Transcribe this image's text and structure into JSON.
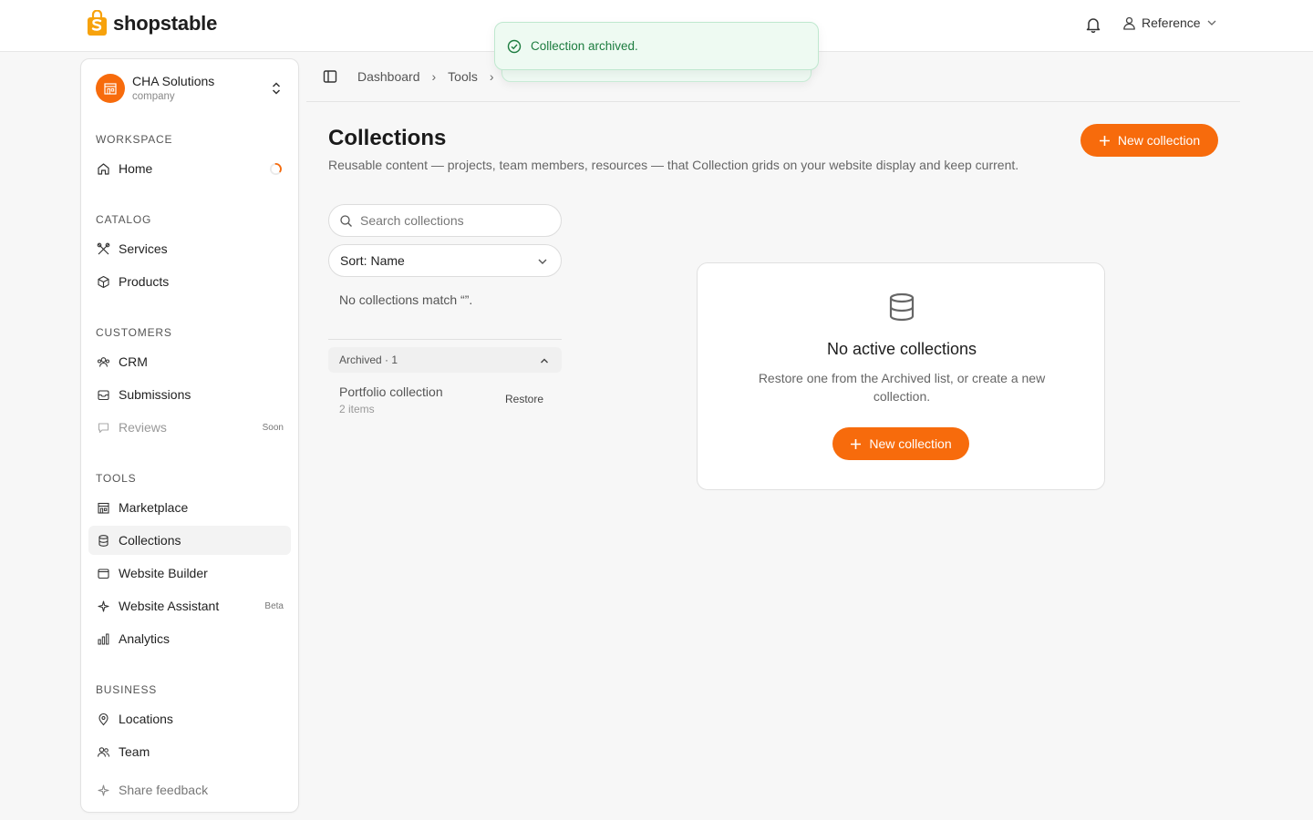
{
  "brand": {
    "name": "shopstable",
    "accent": "#f76b0c"
  },
  "header": {
    "user_label": "Reference"
  },
  "toast": {
    "message": "Collection archived.",
    "color": "#1c7c3f"
  },
  "org": {
    "name": "CHA Solutions",
    "type": "company"
  },
  "sidebar": {
    "sections": [
      {
        "title": "WORKSPACE"
      },
      {
        "title": "CATALOG"
      },
      {
        "title": "CUSTOMERS"
      },
      {
        "title": "TOOLS"
      },
      {
        "title": "BUSINESS"
      }
    ],
    "items": [
      {
        "label": "Home",
        "icon": "home-icon"
      },
      {
        "label": "Services",
        "icon": "tools-icon"
      },
      {
        "label": "Products",
        "icon": "box-icon"
      },
      {
        "label": "CRM",
        "icon": "users-icon"
      },
      {
        "label": "Submissions",
        "icon": "inbox-icon"
      },
      {
        "label": "Reviews",
        "icon": "message-icon",
        "badge": "Soon"
      },
      {
        "label": "Marketplace",
        "icon": "store-icon"
      },
      {
        "label": "Collections",
        "icon": "database-icon",
        "active": true
      },
      {
        "label": "Website Builder",
        "icon": "window-icon"
      },
      {
        "label": "Website Assistant",
        "icon": "sparkles-icon",
        "badge": "Beta"
      },
      {
        "label": "Analytics",
        "icon": "bar-chart-icon"
      },
      {
        "label": "Locations",
        "icon": "map-pin-icon"
      },
      {
        "label": "Team",
        "icon": "team-icon"
      }
    ],
    "feedback_label": "Share feedback"
  },
  "breadcrumb": {
    "items": [
      "Dashboard",
      "Tools"
    ]
  },
  "page": {
    "title": "Collections",
    "subtitle": "Reusable content — projects, team members, resources — that Collection grids on your website display and keep current.",
    "new_button": "New collection"
  },
  "list": {
    "search_placeholder": "Search collections",
    "sort_label": "Sort: Name",
    "no_match": "No collections match “”.",
    "archived_header": "Archived · 1",
    "archived_items": [
      {
        "name": "Portfolio collection",
        "count": "2 items",
        "action": "Restore"
      }
    ]
  },
  "empty_state": {
    "title": "No active collections",
    "description": "Restore one from the Archived list, or create a new collection.",
    "button": "New collection"
  }
}
